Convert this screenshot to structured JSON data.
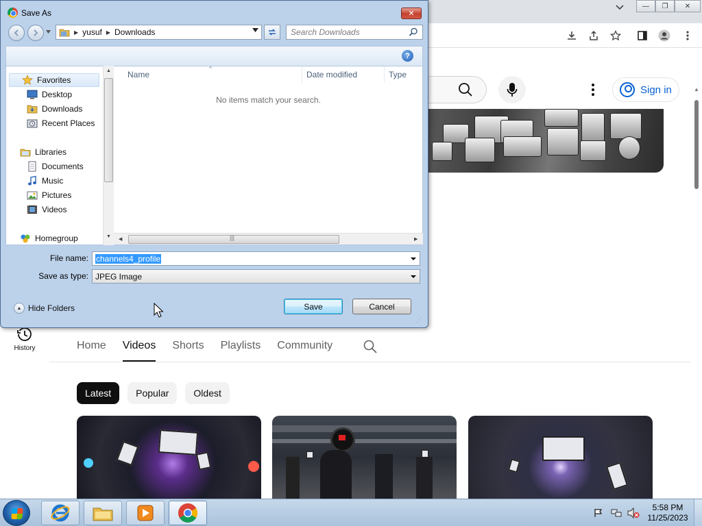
{
  "dialog": {
    "title": "Save As",
    "close_label": "✕",
    "breadcrumb": [
      "yusuf",
      "Downloads"
    ],
    "search_placeholder": "Search Downloads",
    "help_label": "?",
    "nav": {
      "favorites": "Favorites",
      "desktop": "Desktop",
      "downloads": "Downloads",
      "recent_places": "Recent Places",
      "libraries": "Libraries",
      "documents": "Documents",
      "music": "Music",
      "pictures": "Pictures",
      "videos": "Videos",
      "homegroup": "Homegroup"
    },
    "columns": {
      "name": "Name",
      "date_modified": "Date modified",
      "type": "Type"
    },
    "empty_message": "No items match your search.",
    "file_name_label": "File name:",
    "file_name_value": "channels4_profile",
    "save_type_label": "Save as type:",
    "save_type_value": "JPEG Image",
    "hide_folders": "Hide Folders",
    "save_button": "Save",
    "cancel_button": "Cancel"
  },
  "youtube": {
    "sign_in": "Sign in",
    "history_label": "History",
    "tabs": [
      {
        "label": "Home",
        "active": false
      },
      {
        "label": "Videos",
        "active": true
      },
      {
        "label": "Shorts",
        "active": false
      },
      {
        "label": "Playlists",
        "active": false
      },
      {
        "label": "Community",
        "active": false
      }
    ],
    "chips": [
      {
        "label": "Latest",
        "selected": true
      },
      {
        "label": "Popular",
        "selected": false
      },
      {
        "label": "Oldest",
        "selected": false
      }
    ]
  },
  "taskbar": {
    "time": "5:58 PM",
    "date": "11/25/2023",
    "pinned": [
      "internet-explorer",
      "windows-explorer",
      "media-player",
      "chrome"
    ]
  },
  "colors": {
    "youtube_link": "#065fd4",
    "dialog_frame": "#bcd1ea",
    "selection": "#3399ff"
  }
}
